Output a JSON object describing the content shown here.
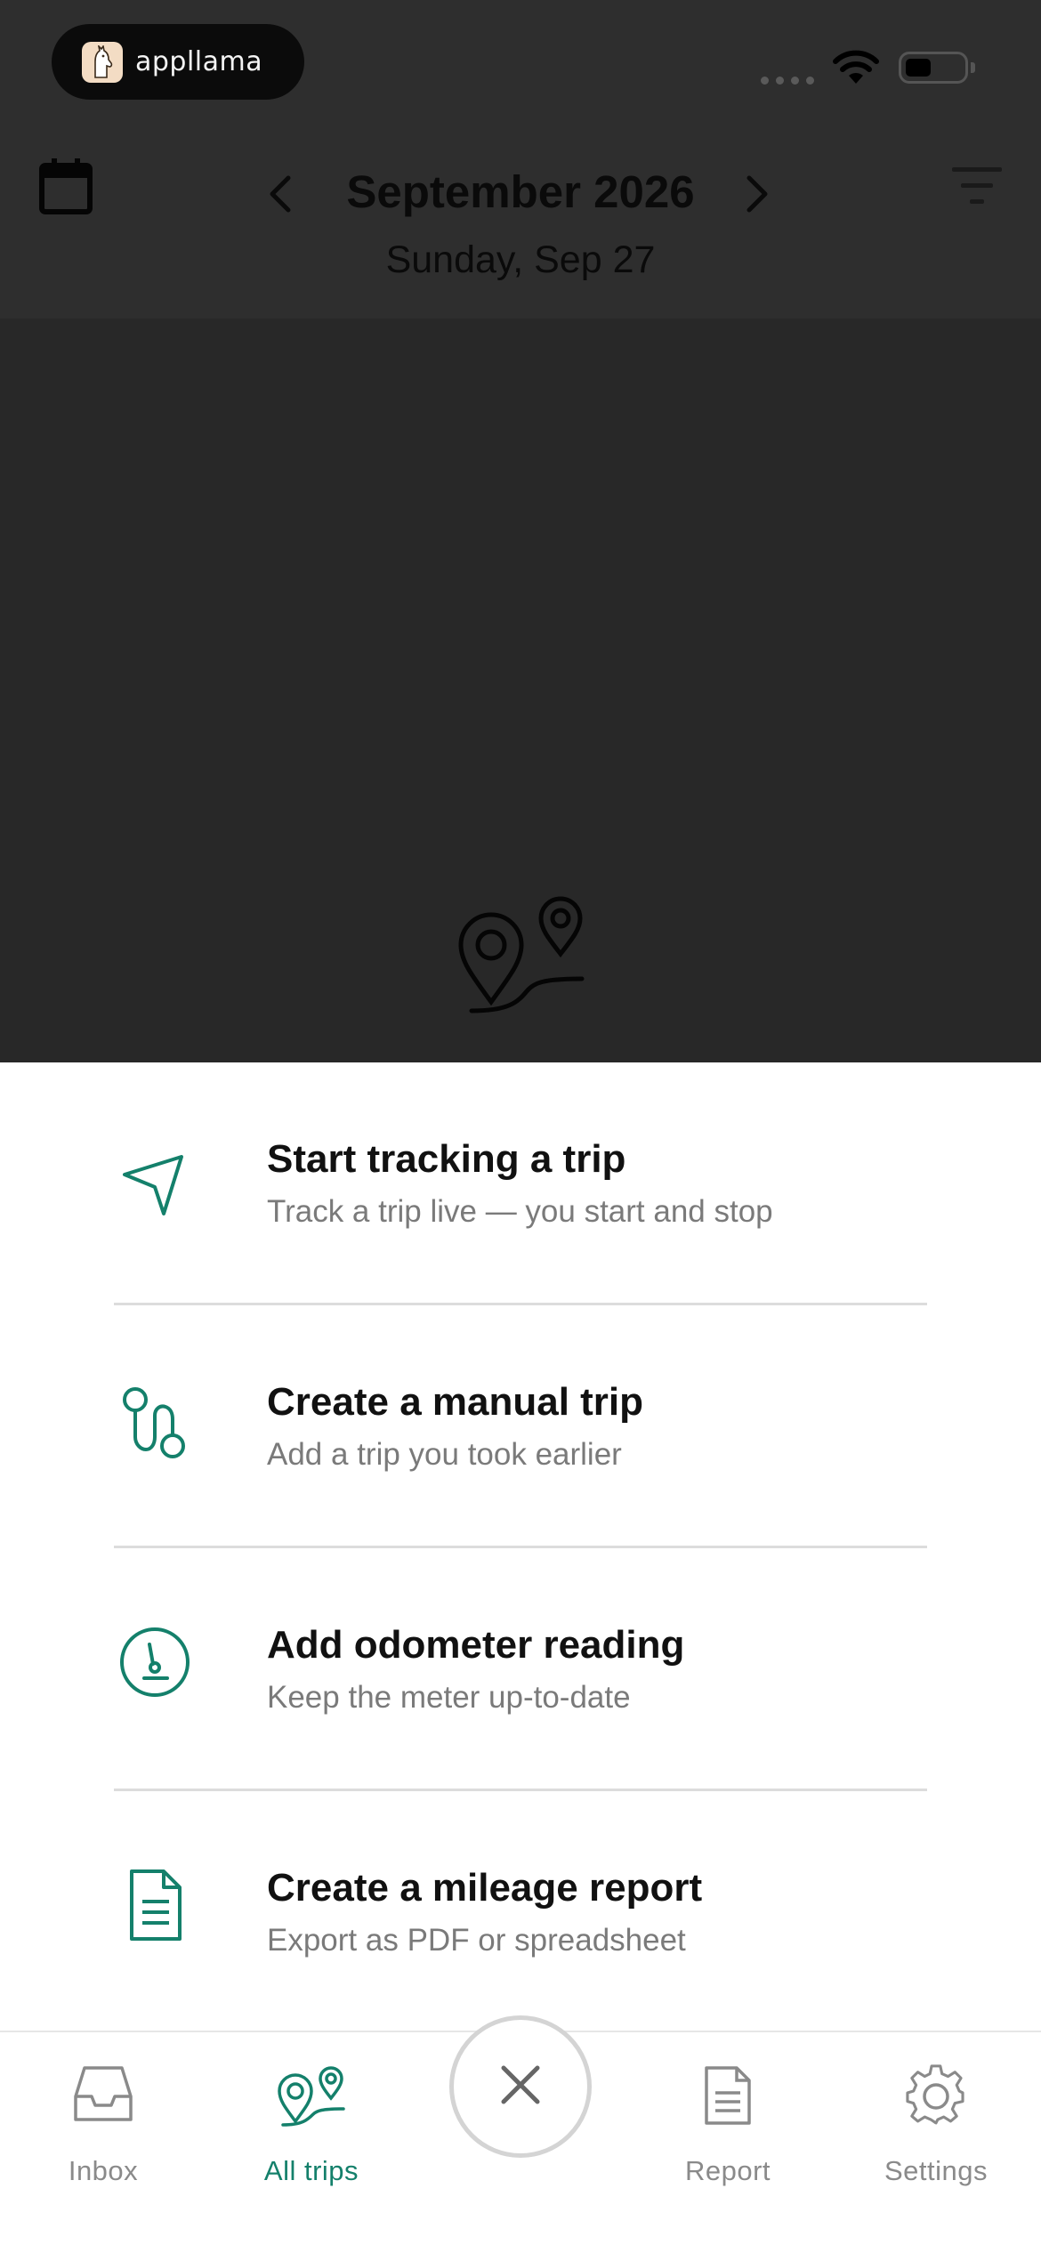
{
  "status_bar": {
    "pill_brand": "appllama"
  },
  "header": {
    "month_title": "September 2026",
    "day_subtitle": "Sunday, Sep 27"
  },
  "actions": [
    {
      "title": "Start tracking a trip",
      "subtitle": "Track a trip live — you start and stop",
      "icon": "navigation-arrow-icon"
    },
    {
      "title": "Create a manual trip",
      "subtitle": "Add a trip you took earlier",
      "icon": "route-icon"
    },
    {
      "title": "Add odometer reading",
      "subtitle": "Keep the meter up-to-date",
      "icon": "odometer-icon"
    },
    {
      "title": "Create a mileage report",
      "subtitle": "Export as PDF or spreadsheet",
      "icon": "document-icon"
    }
  ],
  "tabbar": {
    "tabs": [
      {
        "label": "Inbox",
        "icon": "inbox-tray-icon",
        "active": false
      },
      {
        "label": "All trips",
        "icon": "map-pins-icon",
        "active": true
      },
      {
        "label": "Report",
        "icon": "report-document-icon",
        "active": false
      },
      {
        "label": "Settings",
        "icon": "gear-icon",
        "active": false
      }
    ],
    "close_icon": "close-icon"
  },
  "colors": {
    "accent": "#14806b",
    "overlay": "#2b2b2b",
    "divider": "#dcdcdc",
    "subtitle_text": "#7a7a7a",
    "tab_inactive": "#8a8a8a"
  }
}
